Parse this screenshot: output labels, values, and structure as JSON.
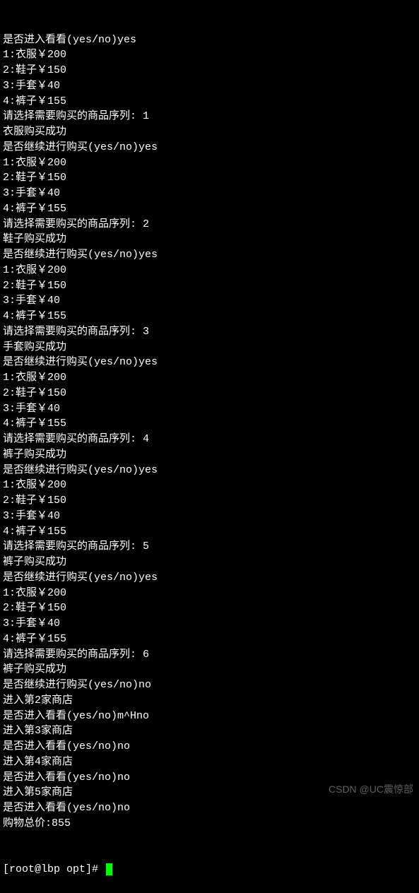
{
  "lines": [
    "是否进入看看(yes/no)yes",
    "1:衣服￥200",
    "2:鞋子￥150",
    "3:手套￥40",
    "4:裤子￥155",
    "请选择需要购买的商品序列: 1",
    "衣服购买成功",
    "是否继续进行购买(yes/no)yes",
    "1:衣服￥200",
    "2:鞋子￥150",
    "3:手套￥40",
    "4:裤子￥155",
    "请选择需要购买的商品序列: 2",
    "鞋子购买成功",
    "是否继续进行购买(yes/no)yes",
    "1:衣服￥200",
    "2:鞋子￥150",
    "3:手套￥40",
    "4:裤子￥155",
    "请选择需要购买的商品序列: 3",
    "手套购买成功",
    "是否继续进行购买(yes/no)yes",
    "1:衣服￥200",
    "2:鞋子￥150",
    "3:手套￥40",
    "4:裤子￥155",
    "请选择需要购买的商品序列: 4",
    "裤子购买成功",
    "是否继续进行购买(yes/no)yes",
    "1:衣服￥200",
    "2:鞋子￥150",
    "3:手套￥40",
    "4:裤子￥155",
    "请选择需要购买的商品序列: 5",
    "裤子购买成功",
    "是否继续进行购买(yes/no)yes",
    "1:衣服￥200",
    "2:鞋子￥150",
    "3:手套￥40",
    "4:裤子￥155",
    "请选择需要购买的商品序列: 6",
    "裤子购买成功",
    "是否继续进行购买(yes/no)no",
    "进入第2家商店",
    "是否进入看看(yes/no)m^Hno",
    "进入第3家商店",
    "是否进入看看(yes/no)no",
    "进入第4家商店",
    "是否进入看看(yes/no)no",
    "进入第5家商店",
    "是否进入看看(yes/no)no",
    "购物总价:855"
  ],
  "prompt": "[root@lbp opt]# ",
  "watermark": "CSDN @UC震惊部"
}
